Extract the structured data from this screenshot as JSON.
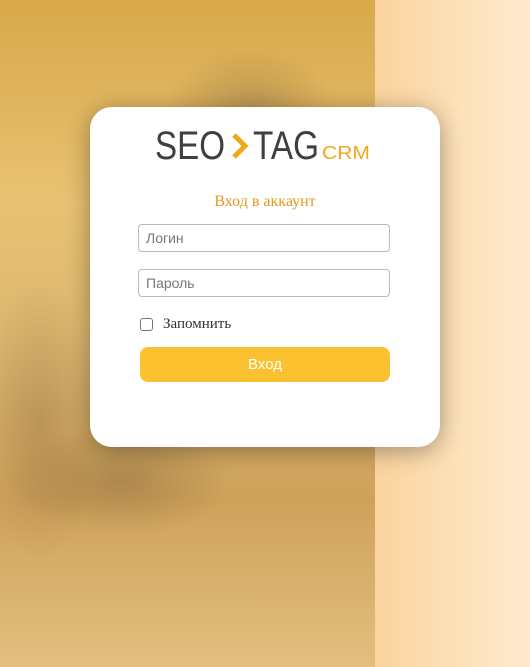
{
  "logo": {
    "seo": "SEO",
    "tag": "TAG",
    "crm": "CRM",
    "colors": {
      "dark": "#3f3f3f",
      "accent": "#f2a71d"
    }
  },
  "form": {
    "title": "Вход в аккаунт",
    "login_placeholder": "Логин",
    "password_placeholder": "Пароль",
    "remember_label": "Запомнить",
    "remember_checked": false,
    "submit_label": "Вход"
  },
  "colors": {
    "title": "#e39a1c",
    "button": "#fcc12e",
    "background": "#fcd9a6"
  }
}
